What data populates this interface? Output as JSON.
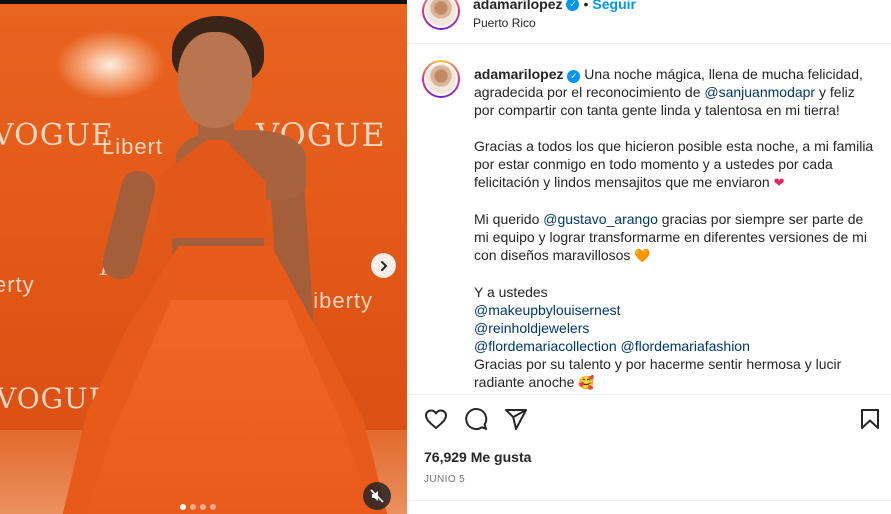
{
  "post": {
    "username": "adamarilopez",
    "separator": "•",
    "follow_label": "Seguir",
    "location": "Puerto Rico",
    "media": {
      "watermarks": [
        "VOGUE",
        "Libert",
        "VOGUE",
        "erty",
        "Fa",
        "Liberty",
        "VOGUE"
      ],
      "carousel_dots": 4,
      "active_dot": 0
    },
    "caption": {
      "username": "adamarilopez",
      "p1_a": " Una noche mágica, llena de mucha felicidad, agradecida por el reconocimiento de ",
      "p1_mention": "@sanjuanmodapr",
      "p1_b": " y feliz por compartir con tanta gente linda y talentosa en mi tierra!",
      "p2": "Gracias a todos los que hicieron posible esta noche, a mi familia por estar conmigo en todo momento y a ustedes por cada felicitación y lindos mensajitos que me enviaron ",
      "p2_emoji": "❤",
      "p3_a": "Mi querido ",
      "p3_mention": "@gustavo_arango",
      "p3_b": " gracias por siempre ser parte de mi equipo y lograr transformarme en diferentes versiones de mi con diseños maravillosos ",
      "p3_emoji": "🧡",
      "p4_intro": "Y a ustedes",
      "mention_1": "@makeupbylouisernest",
      "mention_2": "@reinholdjewelers",
      "mention_3": "@flordemariacollection",
      "mention_4": "@flordemariafashion",
      "p4_end": "Gracias por su talento y por hacerme sentir hermosa y lucir radiante anoche ",
      "p4_emoji": "🥰"
    },
    "likes": "76,929 Me gusta",
    "date": "JUNIO 5",
    "colors": {
      "link": "#00376b",
      "follow": "#0095f6",
      "verified": "#0095f6",
      "dress": "#e85a1a"
    }
  }
}
